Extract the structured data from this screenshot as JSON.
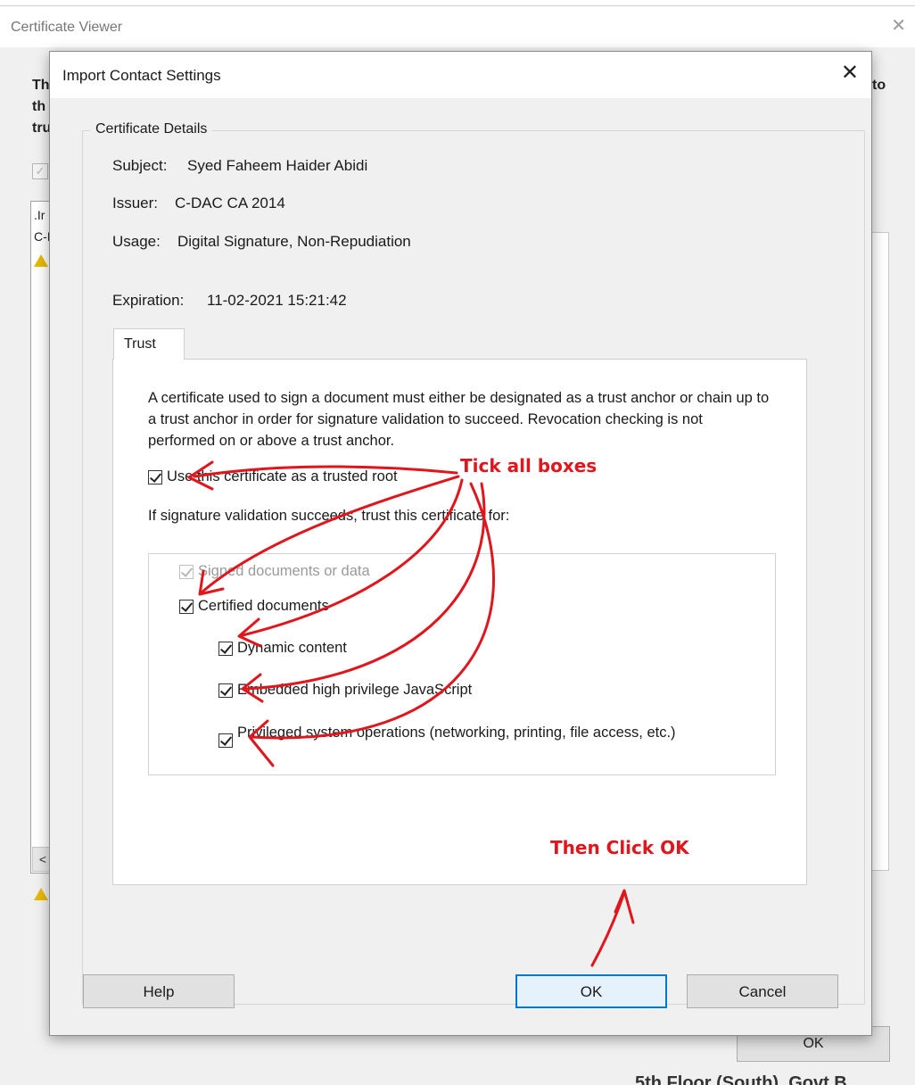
{
  "background_window": {
    "title": "Certificate Viewer",
    "close_glyph": "✕",
    "heading_fragments": [
      "Th",
      "th",
      "tru"
    ],
    "heading_right_fragment": "to",
    "list_fragments": [
      ".Ir",
      "C-I"
    ],
    "scroll_left_glyph": "<",
    "ok_label": "OK",
    "bottom_text": "5th Floor (South), Govt B"
  },
  "dialog": {
    "title": "Import Contact Settings",
    "close_glyph": "✕",
    "group_title": "Certificate Details",
    "subject_label": "Subject:",
    "subject_value": "Syed Faheem Haider Abidi",
    "issuer_label": "Issuer:",
    "issuer_value": "C-DAC CA 2014",
    "usage_label": "Usage:",
    "usage_value": "Digital Signature, Non-Repudiation",
    "expiration_label": "Expiration:",
    "expiration_value": "11-02-2021 15:21:42",
    "tab_label": "Trust",
    "trust_description": "A certificate used to sign a document must either be designated as a trust anchor or chain up to a trust anchor in order for signature validation to succeed.  Revocation checking is not performed on or above a trust anchor.",
    "trusted_root_label": "Use this certificate as a trusted root",
    "trust_prompt": "If signature validation succeeds, trust this certificate for:",
    "options": {
      "signed_documents": "Signed documents or data",
      "certified_documents": "Certified documents",
      "dynamic_content": "Dynamic content",
      "embedded_js": "Embedded high privilege JavaScript",
      "privileged_ops": "Privileged system operations (networking, printing, file access, etc.)"
    },
    "buttons": {
      "help": "Help",
      "ok": "OK",
      "cancel": "Cancel"
    }
  },
  "annotations": {
    "tick_all": "Tick all boxes",
    "then_click": "Then Click OK",
    "color": "#e0161c"
  }
}
